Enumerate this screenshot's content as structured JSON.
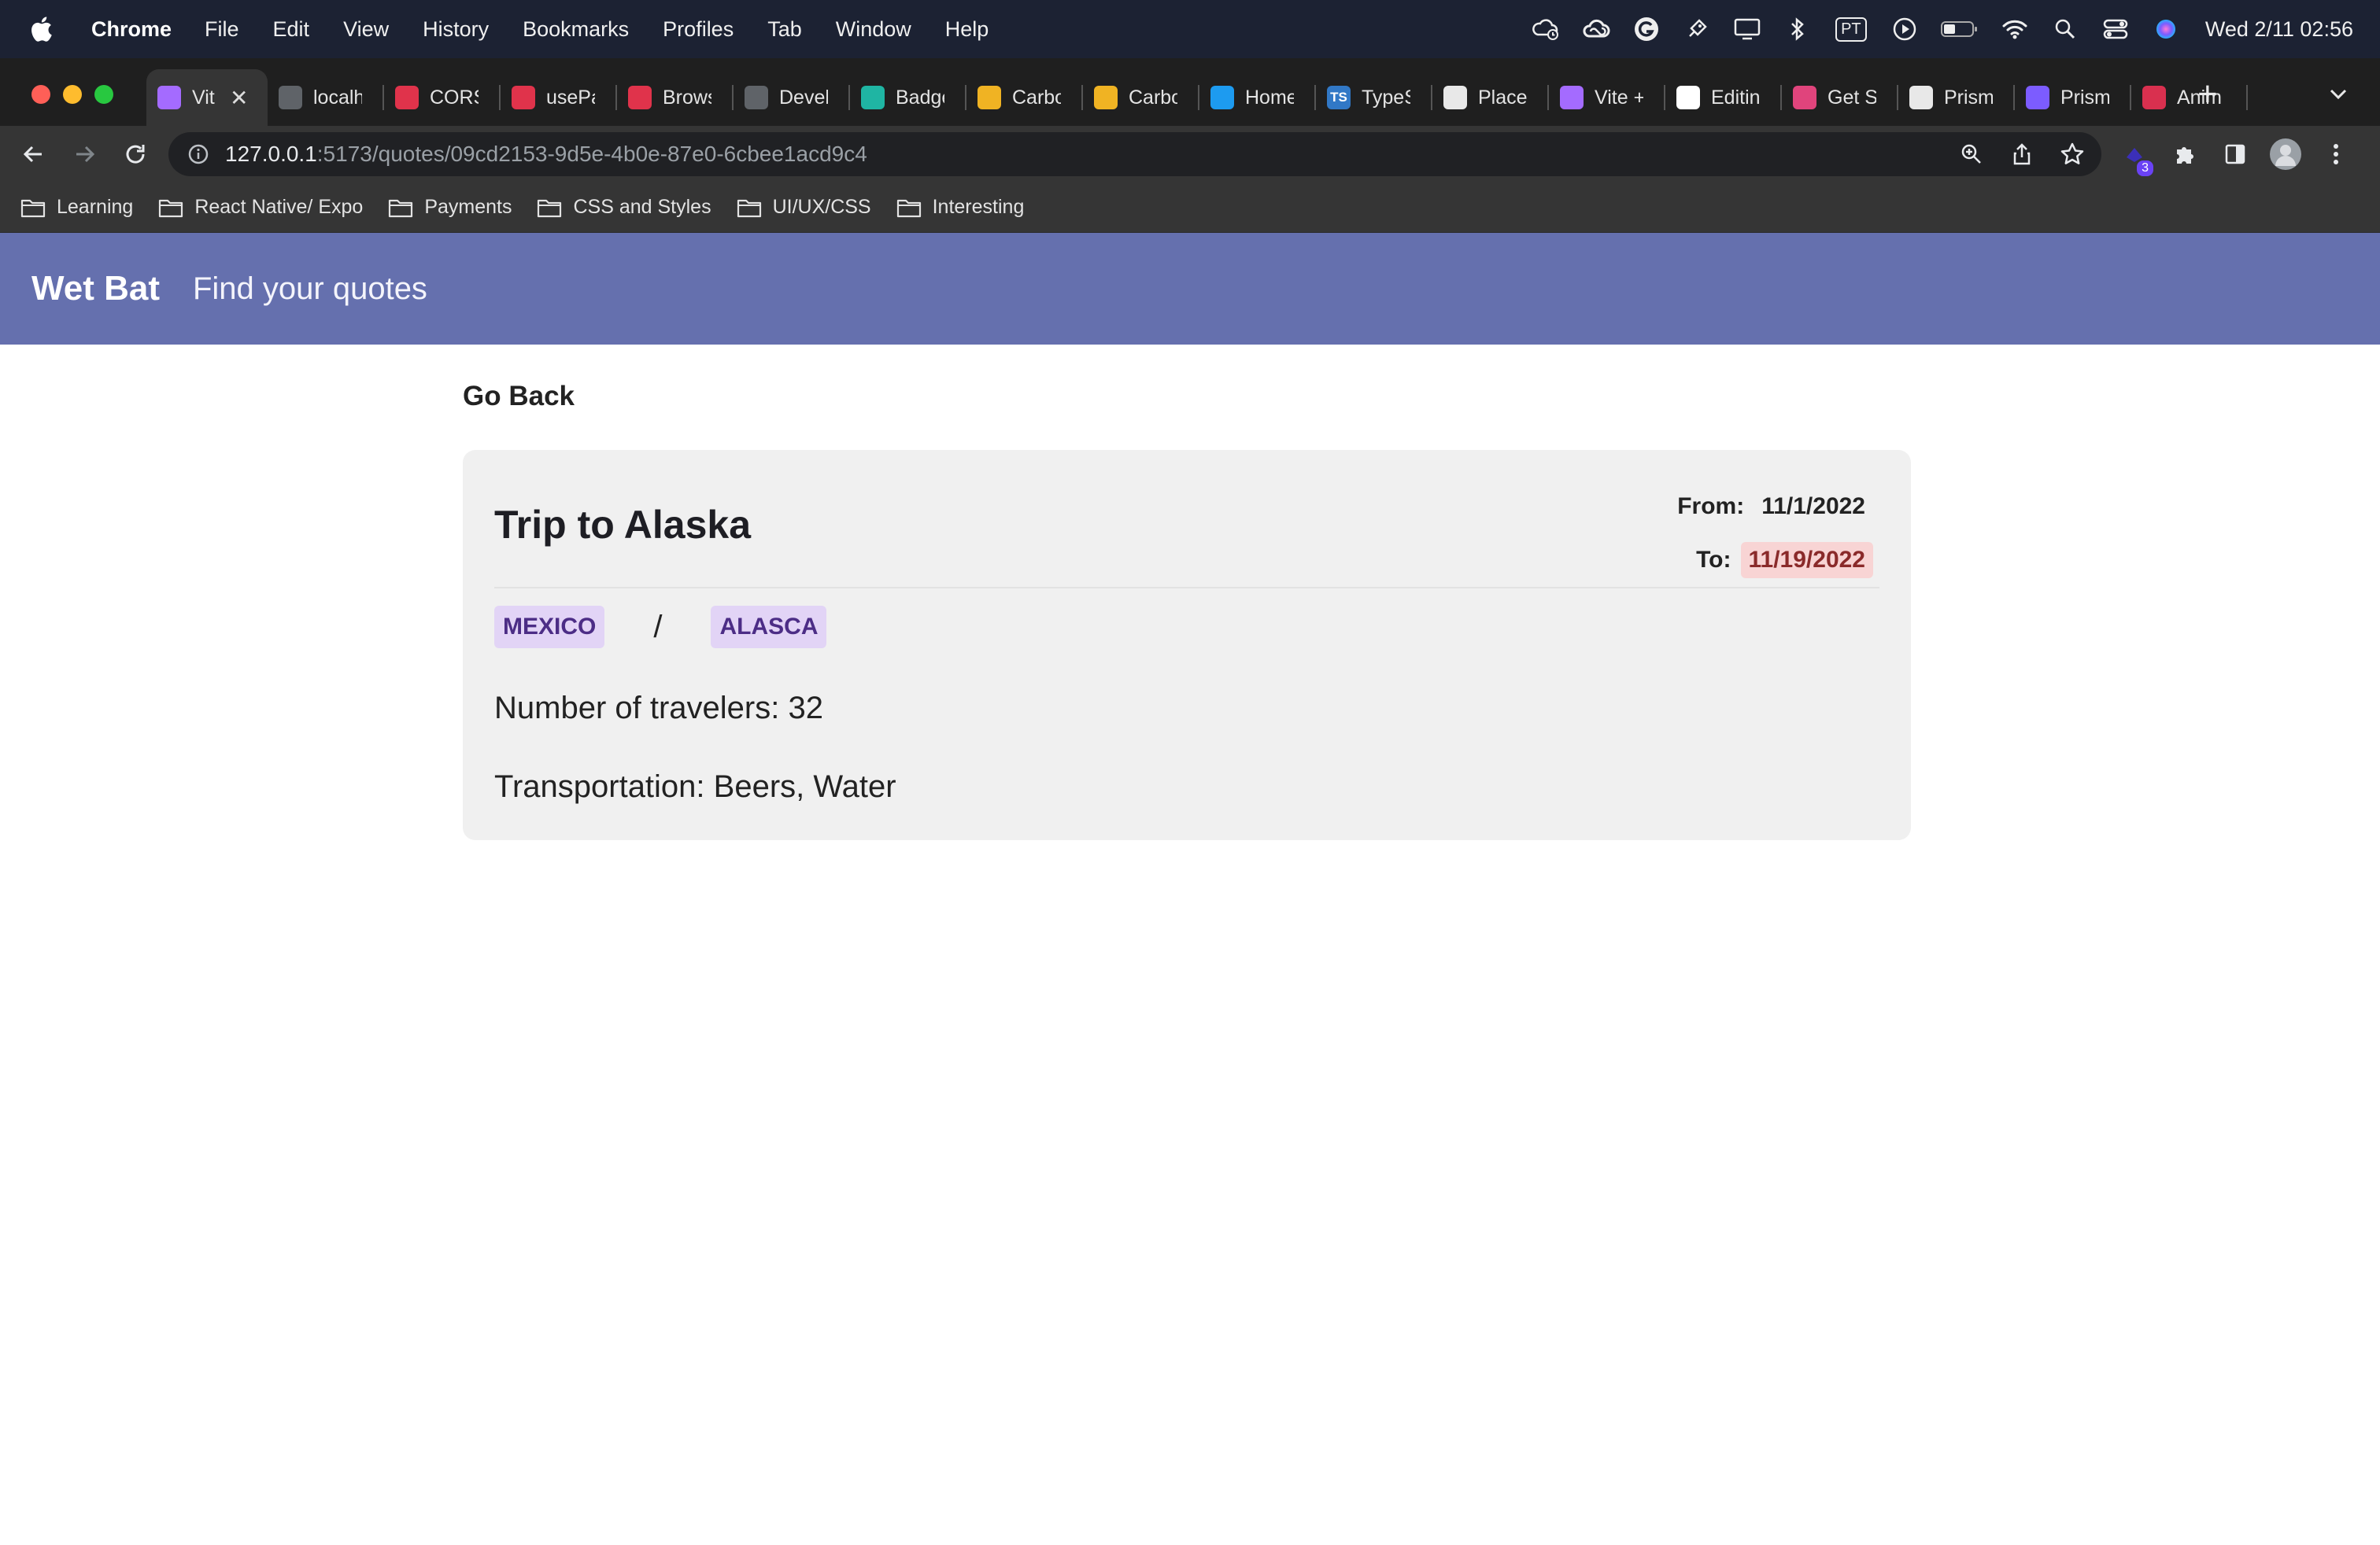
{
  "menubar": {
    "app_name": "Chrome",
    "items": [
      "File",
      "Edit",
      "View",
      "History",
      "Bookmarks",
      "Profiles",
      "Tab",
      "Window",
      "Help"
    ],
    "status_icons": [
      "cloud-icon",
      "creative-cloud-icon",
      "grammarly-icon",
      "rocket-icon",
      "display-icon",
      "bluetooth-icon",
      "input-source-icon",
      "play-icon",
      "battery-icon",
      "wifi-icon",
      "search-icon",
      "control-center-icon",
      "siri-icon"
    ],
    "input_source": "PT",
    "clock": "Wed 2/11  02:56"
  },
  "tabs": [
    {
      "title": "Vit",
      "icon": "vite-icon",
      "color": "#a46bff",
      "active": true
    },
    {
      "title": "localh",
      "icon": "globe-icon",
      "color": "#5f6368"
    },
    {
      "title": "CORS",
      "icon": "cors-icon",
      "color": "#e0334b"
    },
    {
      "title": "usePa",
      "icon": "dots-icon",
      "color": "#e0334b"
    },
    {
      "title": "Brows",
      "icon": "dots-icon",
      "color": "#e0334b"
    },
    {
      "title": "Devel",
      "icon": "globe-icon",
      "color": "#5f6368"
    },
    {
      "title": "Badge",
      "icon": "badge-icon",
      "color": "#1fb5a3"
    },
    {
      "title": "Carbo",
      "icon": "carbon-icon",
      "color": "#f0b323"
    },
    {
      "title": "Carbo",
      "icon": "carbon-icon",
      "color": "#f0b323"
    },
    {
      "title": "Home",
      "icon": "twitter-icon",
      "color": "#1d9bf0"
    },
    {
      "title": "TypeS",
      "icon": "typescript-icon",
      "color": "#3178c6",
      "glyph": "TS"
    },
    {
      "title": "Place",
      "icon": "placeholder-icon",
      "color": "#e8e8e8"
    },
    {
      "title": "Vite +",
      "icon": "vite-icon",
      "color": "#a46bff"
    },
    {
      "title": "Editin",
      "icon": "github-icon",
      "color": "#ffffff"
    },
    {
      "title": "Get S",
      "icon": "app-icon",
      "color": "#e0447c"
    },
    {
      "title": "Prism",
      "icon": "prisma-icon",
      "color": "#e8e8e8"
    },
    {
      "title": "Prism",
      "icon": "prism-icon",
      "color": "#7c5cff"
    },
    {
      "title": "Anim",
      "icon": "doc-icon",
      "color": "#d9304f"
    }
  ],
  "address_bar": {
    "url_host": "127.0.0.1",
    "url_rest": ":5173/quotes/09cd2153-9d5e-4b0e-87e0-6cbee1acd9c4",
    "extension_badge": "3"
  },
  "bookmarks": [
    "Learning",
    "React Native/ Expo",
    "Payments",
    "CSS and Styles",
    "UI/UX/CSS",
    "Interesting"
  ],
  "header": {
    "brand": "Wet Bat",
    "tagline": "Find your quotes"
  },
  "page": {
    "go_back": "Go Back",
    "quote": {
      "title": "Trip to Alaska",
      "from_label": "From:",
      "from_date": "11/1/2022",
      "to_label": "To:",
      "to_date": "11/19/2022",
      "origin": "MEXICO",
      "separator": "/",
      "destination": "ALASCA",
      "travelers_text": "Number of travelers: 32",
      "transportation_text": "Transportation: Beers, Water"
    }
  },
  "colors": {
    "header_bg": "#6570ae",
    "card_bg": "#f0f0f0",
    "badge_bg": "#e2d4f6",
    "badge_text": "#4c2d86",
    "to_date_bg": "#f8d4d4",
    "to_date_text": "#8a2a2a"
  }
}
